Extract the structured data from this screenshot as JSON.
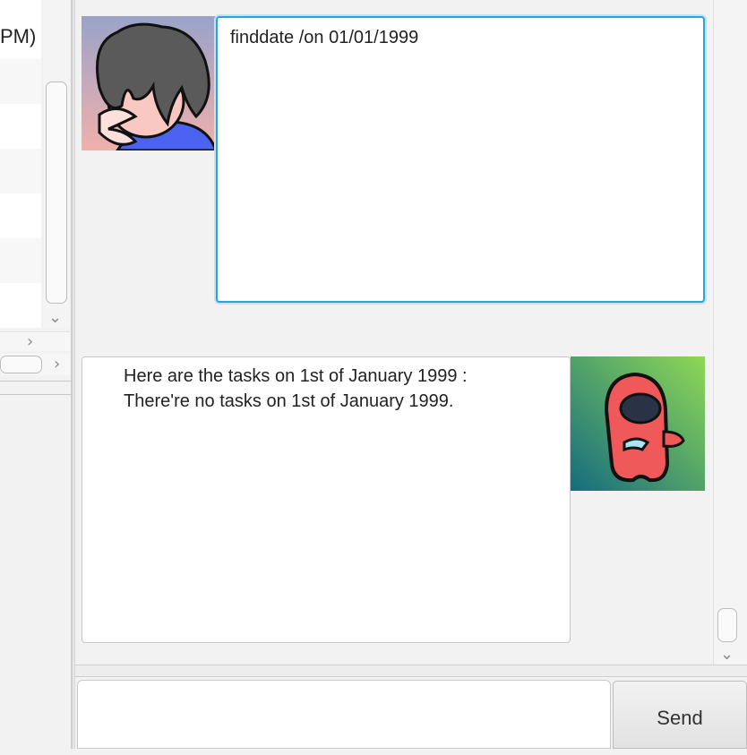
{
  "left_panel": {
    "partial_list_text": "PM)",
    "scroll_icons": [
      "chevron-down-icon",
      "chevron-right-icon"
    ]
  },
  "chat": {
    "messages": [
      {
        "sender": "user",
        "avatar": "user-avatar",
        "text": "finddate /on 01/01/1999"
      },
      {
        "sender": "bot",
        "avatar": "bot-avatar",
        "lines": [
          "Here are the tasks on 1st of January 1999 :",
          "There're no tasks on 1st of January 1999."
        ]
      }
    ]
  },
  "input": {
    "value": "",
    "send_label": "Send"
  },
  "colors": {
    "focus_border": "#2fa3d8",
    "user_avatar_bg_top": "#9aa3c9",
    "user_avatar_bg_bottom": "#f0b0ac",
    "bot_avatar_bg_start": "#8fd856",
    "bot_avatar_bg_end": "#156c7e",
    "bot_character": "#f0595a"
  }
}
